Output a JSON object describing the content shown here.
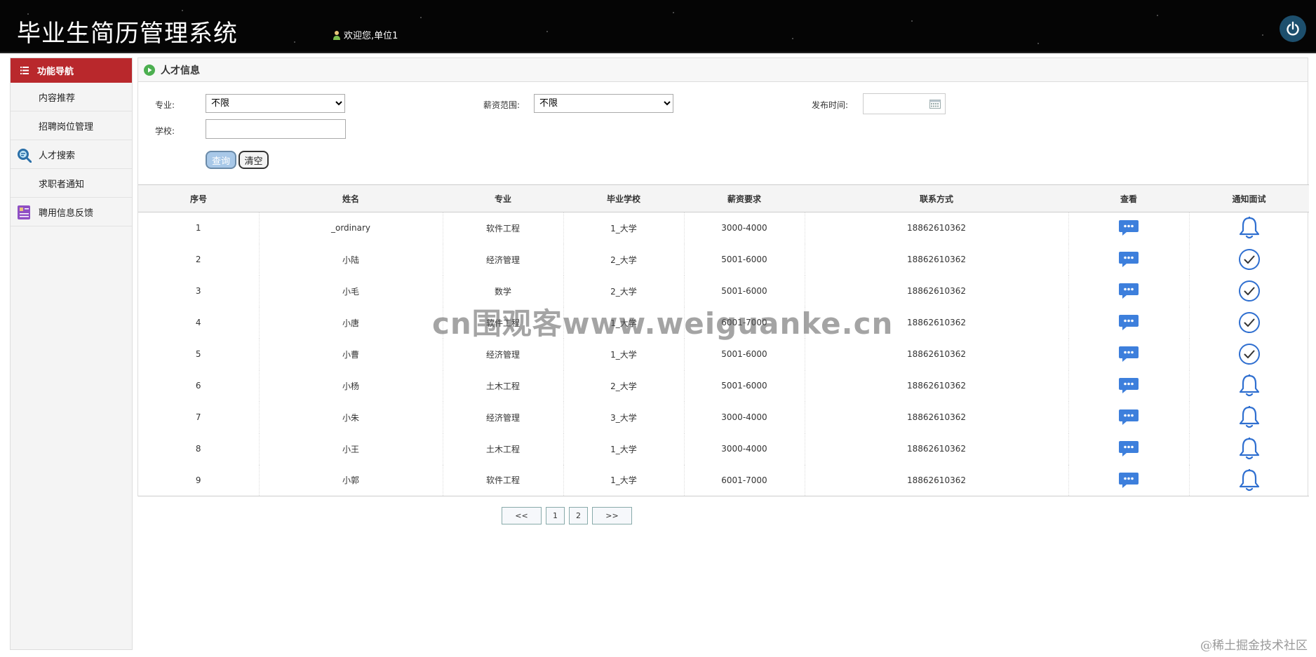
{
  "header": {
    "title": "毕业生简历管理系统",
    "welcome": "欢迎您,单位1"
  },
  "sidebar": {
    "heading": "功能导航",
    "items": [
      {
        "label": "内容推荐"
      },
      {
        "label": "招聘岗位管理"
      },
      {
        "label": "人才搜索"
      },
      {
        "label": "求职者通知"
      },
      {
        "label": "聘用信息反馈"
      }
    ]
  },
  "panel": {
    "title": "人才信息"
  },
  "filters": {
    "major_label": "专业:",
    "major_value": "不限",
    "salary_label": "薪资范围:",
    "salary_value": "不限",
    "date_label": "发布时间:",
    "school_label": "学校:",
    "school_value": "",
    "query_button": "查询",
    "clear_button": "清空"
  },
  "table": {
    "headers": [
      "序号",
      "姓名",
      "专业",
      "毕业学校",
      "薪资要求",
      "联系方式",
      "查看",
      "通知面试"
    ],
    "rows": [
      {
        "no": "1",
        "name": "_ordinary",
        "major": "软件工程",
        "school": "1_大学",
        "salary": "3000-4000",
        "phone": "18862610362",
        "notify": "bell"
      },
      {
        "no": "2",
        "name": "小陆",
        "major": "经济管理",
        "school": "2_大学",
        "salary": "5001-6000",
        "phone": "18862610362",
        "notify": "check"
      },
      {
        "no": "3",
        "name": "小毛",
        "major": "数学",
        "school": "2_大学",
        "salary": "5001-6000",
        "phone": "18862610362",
        "notify": "check"
      },
      {
        "no": "4",
        "name": "小唐",
        "major": "软件工程",
        "school": "1_大学",
        "salary": "6001-7000",
        "phone": "18862610362",
        "notify": "check"
      },
      {
        "no": "5",
        "name": "小曹",
        "major": "经济管理",
        "school": "1_大学",
        "salary": "5001-6000",
        "phone": "18862610362",
        "notify": "check"
      },
      {
        "no": "6",
        "name": "小杨",
        "major": "土木工程",
        "school": "2_大学",
        "salary": "5001-6000",
        "phone": "18862610362",
        "notify": "bell"
      },
      {
        "no": "7",
        "name": "小朱",
        "major": "经济管理",
        "school": "3_大学",
        "salary": "3000-4000",
        "phone": "18862610362",
        "notify": "bell"
      },
      {
        "no": "8",
        "name": "小王",
        "major": "土木工程",
        "school": "1_大学",
        "salary": "3000-4000",
        "phone": "18862610362",
        "notify": "bell"
      },
      {
        "no": "9",
        "name": "小郭",
        "major": "软件工程",
        "school": "1_大学",
        "salary": "6001-7000",
        "phone": "18862610362",
        "notify": "bell"
      }
    ]
  },
  "pagination": {
    "prev": "<<",
    "pages": [
      "1",
      "2"
    ],
    "next": ">>"
  },
  "watermark": "cn围观客www.weiguanke.cn",
  "corner_watermark": "@稀土掘金技术社区",
  "colors": {
    "nav_active": "#b9282c",
    "icon_blue": "#3d7fdc",
    "power_bg": "#1d4f6d"
  }
}
